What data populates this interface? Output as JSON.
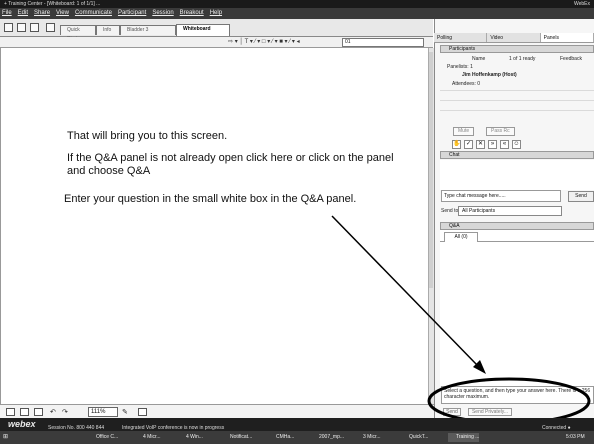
{
  "window": {
    "title": "+ Training Center - [Whiteboard: 1 of 1/1] ...",
    "title_right": "WebEx"
  },
  "menu": [
    "File",
    "Edit",
    "Share",
    "View",
    "Communicate",
    "Participant",
    "Session",
    "Breakout",
    "Help"
  ],
  "tabs": [
    "Quick Start",
    "Info",
    "Bladder 3",
    "Whiteboard"
  ],
  "active_tab_index": 3,
  "draw_toolbar": {
    "tools": "⇨ ▾ │ T ▾ ⁄ ▾ □ ▾ ⁄ ▾ ■ ▾ ⁄ ▾ ◂",
    "page_value": "01"
  },
  "whiteboard": {
    "line1": "That will bring you to this screen.",
    "line2": "If the Q&A panel is not already open click here or click on the panel",
    "line3": "and choose Q&A",
    "line4": "Enter your question in the small white box in the Q&A panel."
  },
  "bottom_toolbar": {
    "zoom": "111%"
  },
  "panel_tabs": [
    "Polling",
    "Video",
    "Panels"
  ],
  "participants": {
    "header": "Participants",
    "column_name": "Name",
    "status": "1 of 1 ready",
    "feedback": "Feedback",
    "panelists_label": "Panelists: 1",
    "host": "Jim Hoffenkamp (Host)",
    "attendees_label": "Attendees: 0",
    "mute_label": "Mute",
    "pass_label": "Pass Rc"
  },
  "chat": {
    "header": "Chat",
    "placeholder": "Type chat message here.....",
    "send_label": "Send",
    "send_to_label": "Send to:",
    "send_to_value": "All Participants"
  },
  "qa": {
    "header": "Q&A",
    "all_tab": "All (0)",
    "input_text": "Select a question, and then type your answer here. There is a 256 character maximum.",
    "send_label": "Send",
    "send_private_label": "Send Privately..."
  },
  "status_bar": {
    "logo": "webex",
    "session": "Session No. 800 440 844",
    "message": "Integrated VoIP conference is now in progress",
    "connection": "Connected ●"
  },
  "taskbar": {
    "items": [
      "Office C...",
      "4 Micr...",
      "4 Win...",
      "Notificat...",
      "CMHa...",
      "2007_mp...",
      "3 Micr...",
      "QuickT...",
      "Training ..."
    ],
    "clock": "5:03 PM"
  }
}
